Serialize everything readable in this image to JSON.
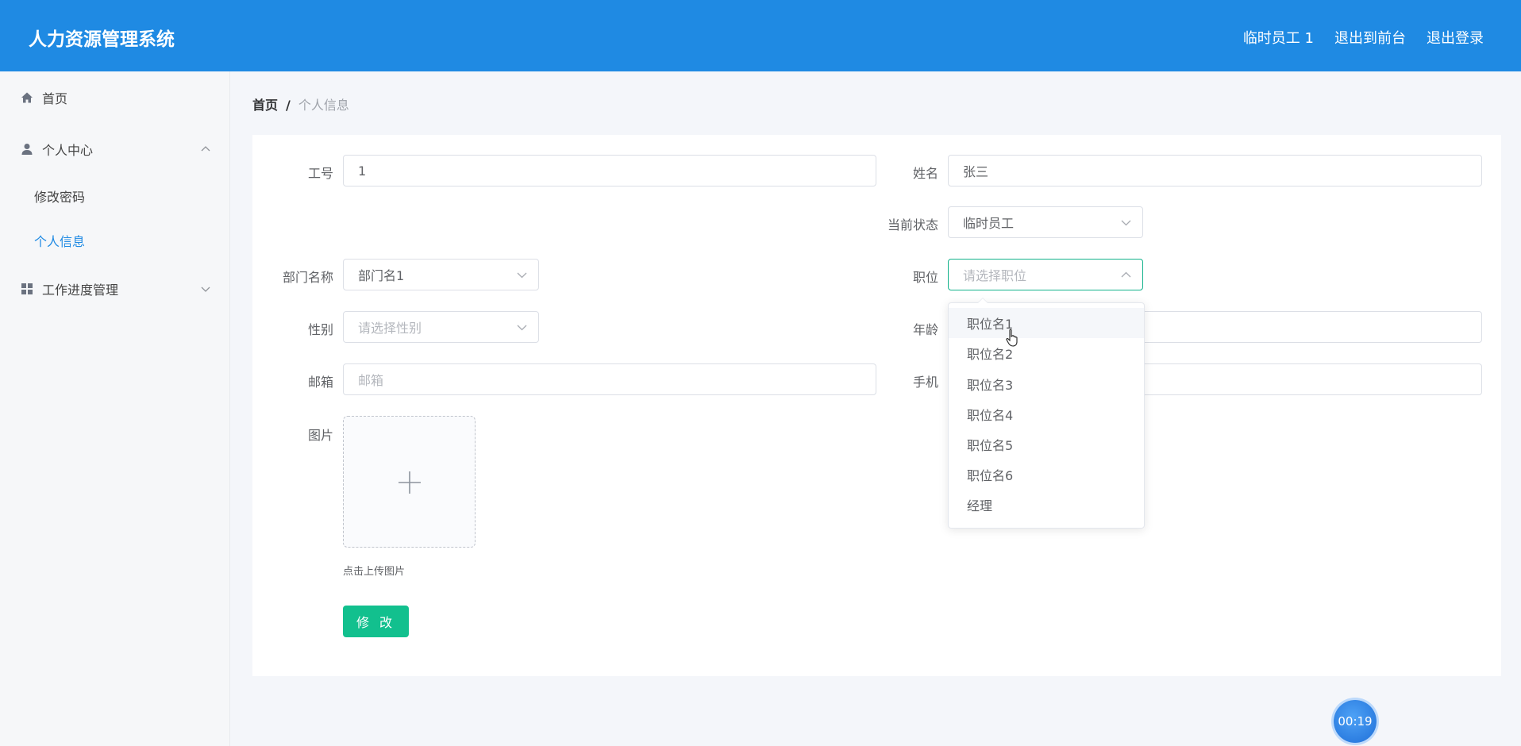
{
  "header": {
    "title": "人力资源管理系统",
    "user": "临时员工 1",
    "to_front": "退出到前台",
    "logout": "退出登录"
  },
  "sidebar": {
    "home": "首页",
    "personal_center": "个人中心",
    "change_password": "修改密码",
    "personal_info": "个人信息",
    "work_progress": "工作进度管理"
  },
  "breadcrumb": {
    "home": "首页",
    "separator": "/",
    "current": "个人信息"
  },
  "form": {
    "employee_id_label": "工号",
    "employee_id_value": "1",
    "name_label": "姓名",
    "name_value": "张三",
    "status_label": "当前状态",
    "status_value": "临时员工",
    "department_label": "部门名称",
    "department_value": "部门名1",
    "position_label": "职位",
    "position_placeholder": "请选择职位",
    "gender_label": "性别",
    "gender_placeholder": "请选择性别",
    "age_label": "年龄",
    "email_label": "邮箱",
    "email_placeholder": "邮箱",
    "phone_label": "手机",
    "image_label": "图片",
    "upload_tip": "点击上传图片",
    "submit": "修 改"
  },
  "position_options": [
    "职位名1",
    "职位名2",
    "职位名3",
    "职位名4",
    "职位名5",
    "职位名6",
    "经理"
  ],
  "timer": "00:19",
  "colors": {
    "header": "#1f8ae3",
    "accent": "#12c08e",
    "active_menu": "#1f8ae3"
  }
}
